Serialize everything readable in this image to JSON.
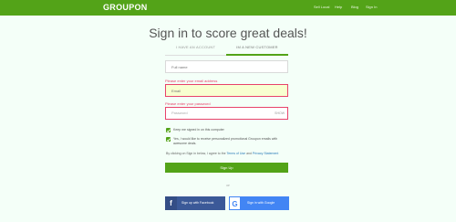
{
  "header": {
    "logo": "GROUPON",
    "nav": [
      "Sell Local",
      "Help",
      "Blog",
      "Sign In"
    ]
  },
  "title": "Sign in to score great deals!",
  "tabs": [
    "I HAVE AN ACCOUNT",
    "IM A NEW CUSTOMER"
  ],
  "form": {
    "fullname_placeholder": "Full name",
    "email_error": "Please enter your email address",
    "email_placeholder": "Email",
    "password_error": "Please enter your password",
    "password_placeholder": "Password",
    "show_label": "SHOW",
    "check1": "Keep me signed in on this computer",
    "check2": "Yes, I would like to receive personalized promotional Groupon emails with awesome deals.",
    "agree_prefix": "By clicking on Sign in below, I agree to the ",
    "terms": "Terms of Use",
    "agree_mid": " and ",
    "privacy": "Privacy Statement",
    "signup": "Sign Up"
  },
  "or": "or",
  "social": {
    "facebook": "Sign up with Facebook",
    "facebook_glyph": "f",
    "google": "Sign in with Google",
    "google_glyph": "G"
  },
  "colors": {
    "brand_green": "#53a318",
    "error": "#e8436b",
    "facebook": "#3b5998",
    "google": "#4285f4"
  },
  "icons": [
    "facebook-icon",
    "google-icon",
    "checkbox-checked-icon"
  ]
}
